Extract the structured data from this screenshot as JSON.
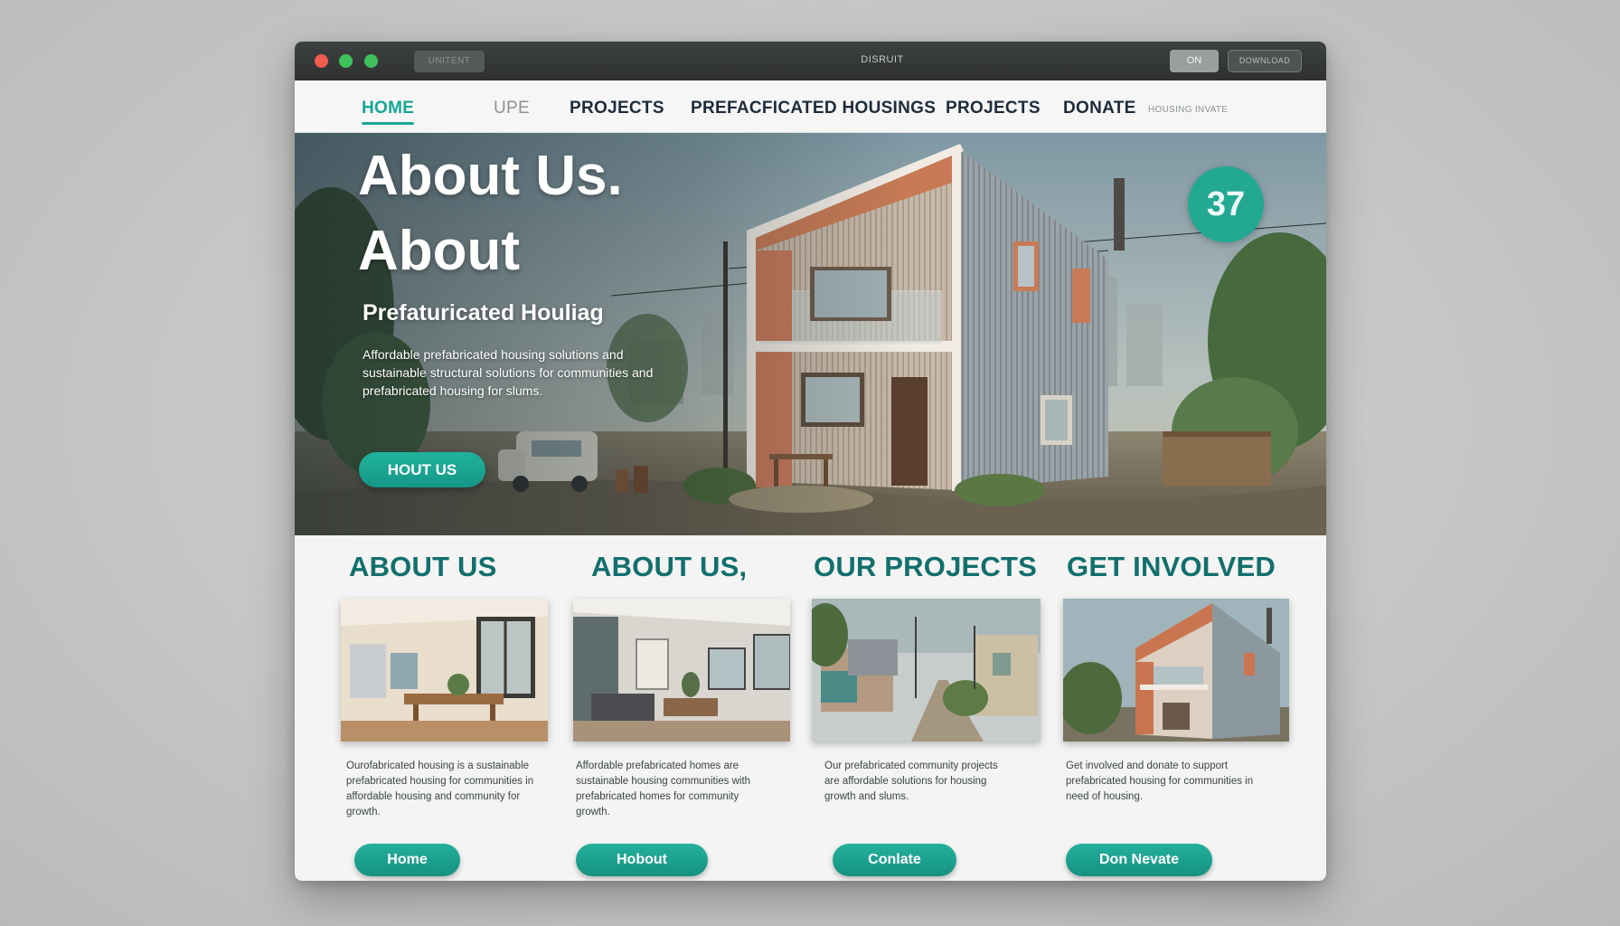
{
  "window": {
    "address": "UNITENT",
    "title": "DISRUIT",
    "btn_primary": "ON",
    "btn_secondary": "DOWNLOAD"
  },
  "nav": {
    "items": [
      {
        "label": "HOME"
      },
      {
        "label": "UPE"
      },
      {
        "label": "PROJECTS"
      },
      {
        "label": "PREFACFICATED HOUSINGS"
      },
      {
        "label": "PROJECTS"
      },
      {
        "label": "DONATE"
      },
      {
        "label": "HOUSING INVATE"
      }
    ]
  },
  "hero": {
    "title_line1": "About Us.",
    "title_line2": "About",
    "subtitle": "Prefaturicated Houliag",
    "paragraph": "Affordable prefabricated housing solutions and sustainable structural solutions for communities and prefabricated housing for slums.",
    "cta": "HOUT US",
    "badge": "37"
  },
  "columns": [
    {
      "heading": "ABOUT US",
      "text": "Ourofabricated housing is a sustainable prefabricated housing for communities in affordable housing and community for growth.",
      "button": "Home"
    },
    {
      "heading": "ABOUT US,",
      "text": "Affordable prefabricated homes are sustainable housing communities with prefabricated homes for community growth.",
      "button": "Hobout"
    },
    {
      "heading": "OUR PROJECTS",
      "text": "Our prefabricated community projects are affordable solutions for housing growth and slums.",
      "button": "Conlate"
    },
    {
      "heading": "GET INVOLVED",
      "text": "Get involved and donate to support prefabricated housing for communities in need of housing.",
      "button": "Don Nevate"
    }
  ],
  "colors": {
    "accent": "#17a696",
    "heading": "#126f6c",
    "nav_text": "#1e2b3a"
  }
}
